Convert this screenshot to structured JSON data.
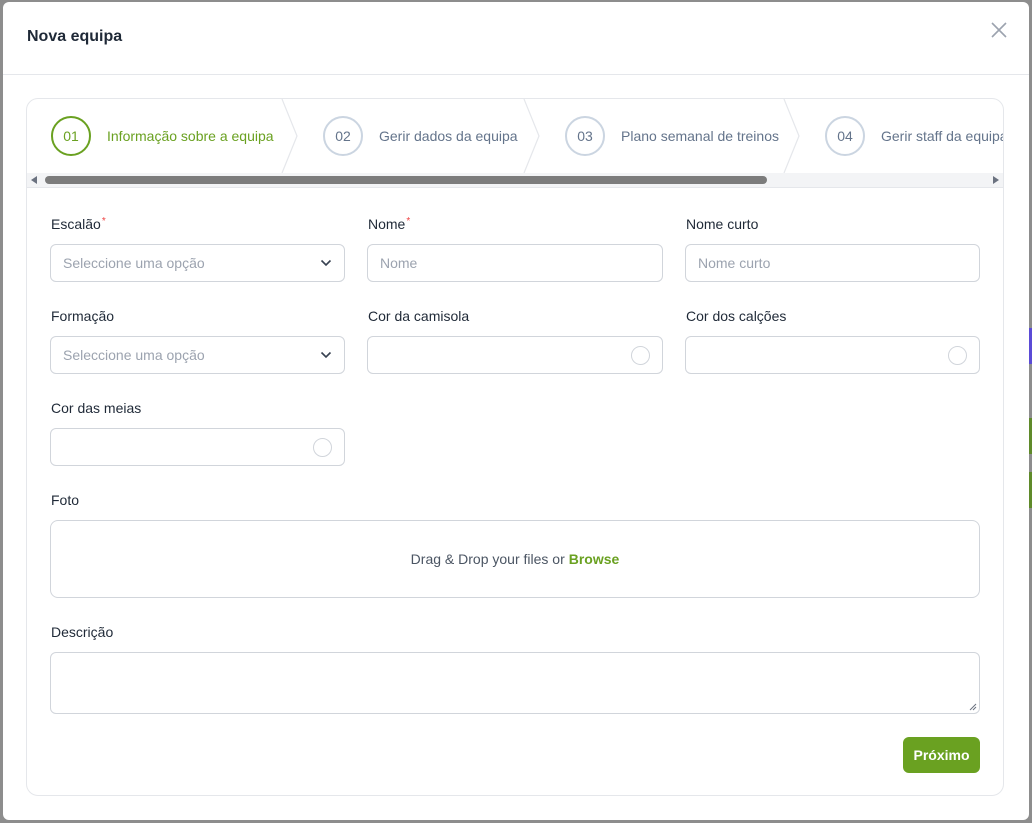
{
  "modal": {
    "title": "Nova equipa"
  },
  "stepper": {
    "steps": [
      {
        "number": "01",
        "label": "Informação sobre a equipa",
        "active": true
      },
      {
        "number": "02",
        "label": "Gerir dados da equipa",
        "active": false
      },
      {
        "number": "03",
        "label": "Plano semanal de treinos",
        "active": false
      },
      {
        "number": "04",
        "label": "Gerir staff da equipa",
        "active": false
      }
    ]
  },
  "form": {
    "escalao": {
      "label": "Escalão",
      "required": "*",
      "placeholder": "Seleccione uma opção"
    },
    "nome": {
      "label": "Nome",
      "required": "*",
      "placeholder": "Nome"
    },
    "nome_curto": {
      "label": "Nome curto",
      "placeholder": "Nome curto"
    },
    "formacao": {
      "label": "Formação",
      "placeholder": "Seleccione uma opção"
    },
    "cor_camisola": {
      "label": "Cor da camisola"
    },
    "cor_calcoes": {
      "label": "Cor dos calções"
    },
    "cor_meias": {
      "label": "Cor das meias"
    },
    "foto": {
      "label": "Foto",
      "dropzone_text": "Drag & Drop your files or",
      "browse_label": "Browse"
    },
    "descricao": {
      "label": "Descrição"
    }
  },
  "actions": {
    "next_label": "Próximo"
  },
  "colors": {
    "accent": "#6aa121",
    "required": "#ef4444"
  }
}
